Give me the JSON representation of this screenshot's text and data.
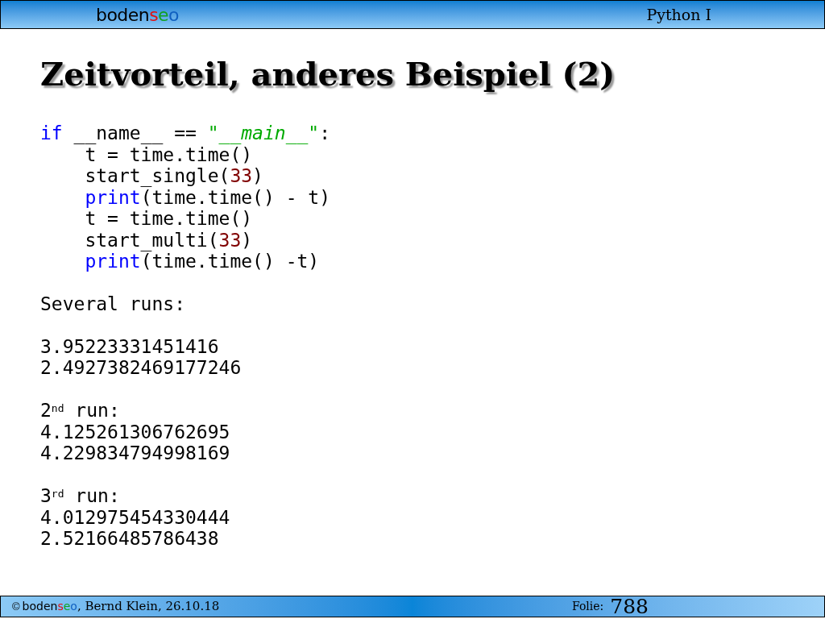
{
  "header": {
    "logo": [
      {
        "text": "boden",
        "color": "#000000"
      },
      {
        "text": "s",
        "color": "#e01010"
      },
      {
        "text": "e",
        "color": "#10a020"
      },
      {
        "text": "o",
        "color": "#1060c0"
      }
    ],
    "course": "Python I"
  },
  "slide": {
    "title": "Zeitvorteil, anderes Beispiel (2)",
    "code": [
      {
        "indented": false,
        "tokens": [
          {
            "kind": "keyword",
            "text": "if"
          },
          {
            "kind": "plain",
            "text": " __name__ == "
          },
          {
            "kind": "string",
            "text": "\""
          },
          {
            "kind": "string_italic",
            "text": "__main__"
          },
          {
            "kind": "string",
            "text": "\""
          },
          {
            "kind": "plain",
            "text": ":"
          }
        ]
      },
      {
        "indented": true,
        "tokens": [
          {
            "kind": "plain",
            "text": "t = time.time()"
          }
        ]
      },
      {
        "indented": true,
        "tokens": [
          {
            "kind": "plain",
            "text": "start_single("
          },
          {
            "kind": "number",
            "text": "33"
          },
          {
            "kind": "plain",
            "text": ")"
          }
        ]
      },
      {
        "indented": true,
        "tokens": [
          {
            "kind": "keyword",
            "text": "print"
          },
          {
            "kind": "plain",
            "text": "(time.time() - t)"
          }
        ]
      },
      {
        "indented": true,
        "tokens": [
          {
            "kind": "plain",
            "text": "t = time.time()"
          }
        ]
      },
      {
        "indented": true,
        "tokens": [
          {
            "kind": "plain",
            "text": "start_multi("
          },
          {
            "kind": "number",
            "text": "33"
          },
          {
            "kind": "plain",
            "text": ")"
          }
        ]
      },
      {
        "indented": true,
        "tokens": [
          {
            "kind": "keyword",
            "text": "print"
          },
          {
            "kind": "plain",
            "text": "(time.time() -t)"
          }
        ]
      }
    ],
    "output": [
      [
        "Several runs:"
      ],
      [
        "3.95223331451416",
        "2.4927382469177246"
      ],
      [
        "2$^{nd}$ run:",
        "4.125261306762695",
        "4.229834794998169"
      ],
      [
        "3$^{rd}$ run:",
        "4.012975454330444",
        "2.52166485786438"
      ]
    ]
  },
  "footer": {
    "copyright": "©",
    "logo": [
      {
        "text": "boden",
        "color": "#000000"
      },
      {
        "text": "s",
        "color": "#e01010"
      },
      {
        "text": "e",
        "color": "#10a020"
      },
      {
        "text": "o",
        "color": "#1060c0"
      }
    ],
    "author": ", Bernd Klein, 26.10.18",
    "folie_label": "Folie:",
    "folie_number": "788"
  }
}
